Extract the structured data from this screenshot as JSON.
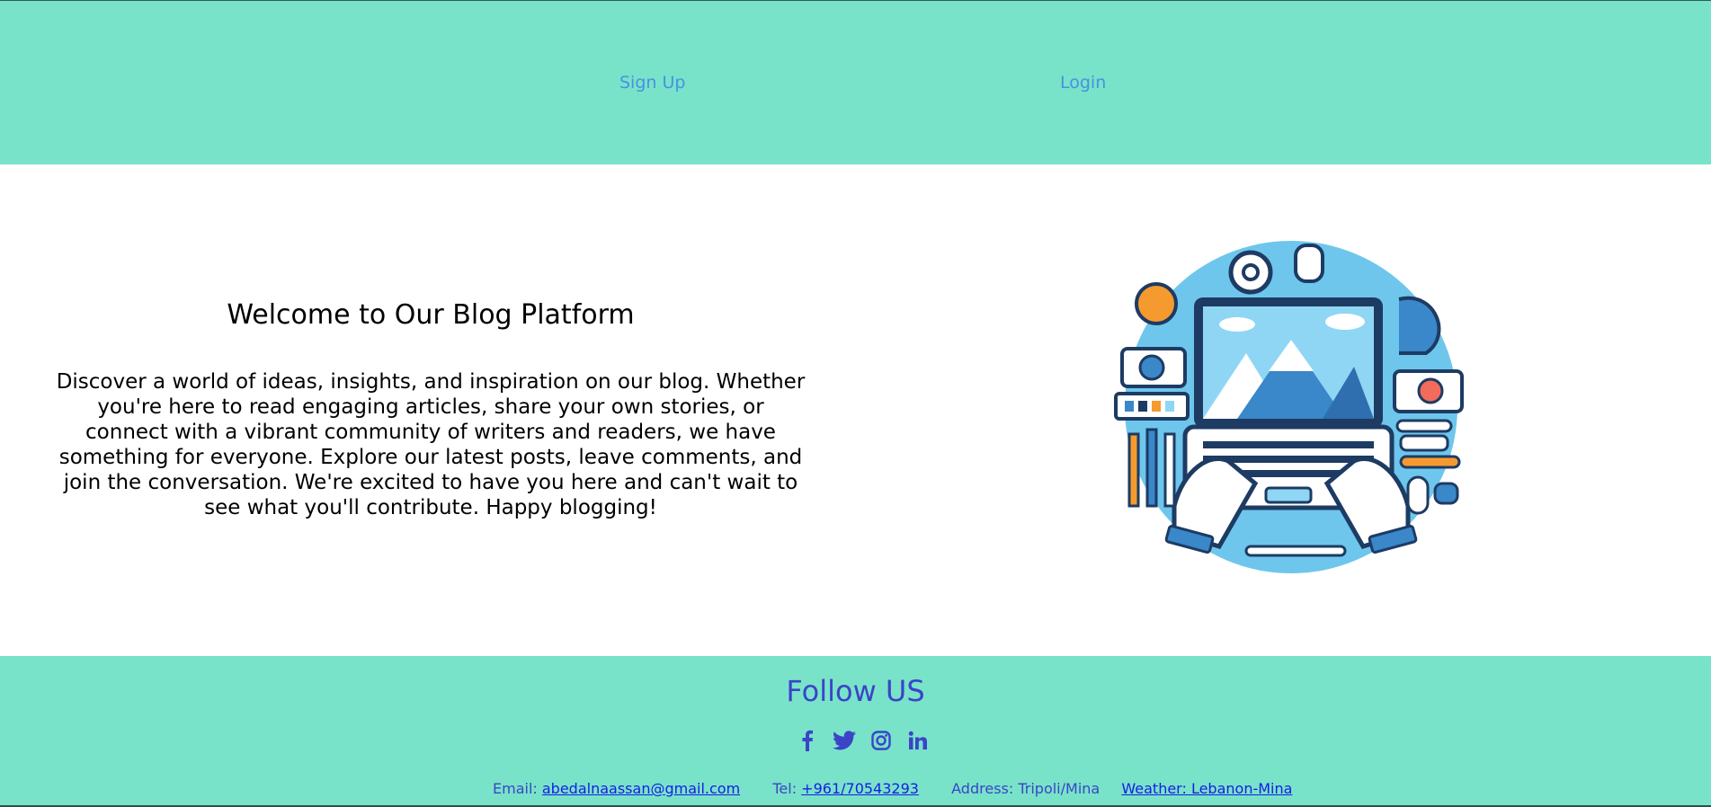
{
  "nav": {
    "signup_label": "Sign Up",
    "login_label": "Login"
  },
  "hero": {
    "title": "Welcome to Our Blog Platform",
    "text": "Discover a world of ideas, insights, and inspiration on our blog. Whether you're here to read engaging articles, share your own stories, or connect with a vibrant community of writers and readers, we have something for everyone. Explore our latest posts, leave comments, and join the conversation. We're excited to have you here and can't wait to see what you'll contribute. Happy blogging!"
  },
  "footer": {
    "follow_title": "Follow US",
    "socials": [
      "facebook-icon",
      "twitter-icon",
      "instagram-icon",
      "linkedin-icon"
    ],
    "email_label": "Email:",
    "email_value": "abedalnaassan@gmail.com",
    "tel_label": "Tel:",
    "tel_value": "+961/70543293",
    "address_text": "Address: Tripoli/Mina",
    "weather_link": "Weather: Lebanon-Mina"
  },
  "colors": {
    "band": "#78e3c9",
    "nav_link": "#4a90e2",
    "footer_text": "#3b44c7",
    "link": "#1a1ae6"
  }
}
